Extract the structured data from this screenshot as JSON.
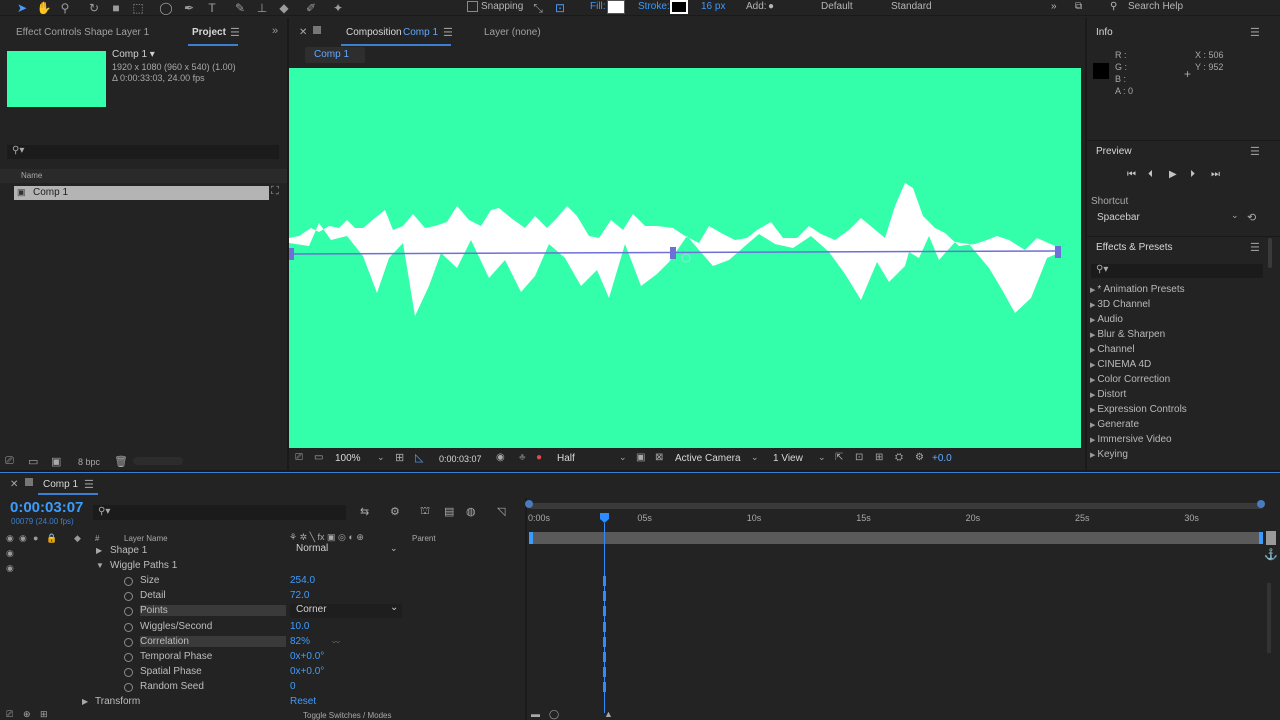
{
  "toolbar": {
    "snapping_label": "Snapping",
    "fill_label": "Fill:",
    "stroke_label": "Stroke:",
    "stroke_size": "16 px",
    "add_label": "Add:",
    "workspace_default": "Default",
    "workspace_standard": "Standard",
    "search_help": "Search Help"
  },
  "left_panel": {
    "tab_effect_controls": "Effect Controls Shape Layer 1",
    "tab_project": "Project",
    "comp_name": "Comp 1 ▾",
    "comp_dims": "1920 x 1080  (960 x 540) (1.00)",
    "comp_duration": "Δ 0:00:33:03, 24.00 fps",
    "thumb_color": "#33ffaa",
    "search_placeholder": "",
    "column_name": "Name",
    "items": [
      {
        "label": "Comp 1"
      }
    ],
    "footer_bpc": "8 bpc"
  },
  "viewer": {
    "tab_composition": "Composition",
    "tab_comp_name": "Comp 1",
    "tab_layer": "Layer (none)",
    "breadcrumb": "Comp 1",
    "bg_color": "#33ffaa",
    "zoom": "100%",
    "timecode": "0:00:03:07",
    "resolution": "Half",
    "camera": "Active Camera",
    "view": "1 View",
    "exposure": "+0.0"
  },
  "info_panel": {
    "title": "Info",
    "r_label": "R :",
    "g_label": "G :",
    "b_label": "B :",
    "a_label": "A : 0",
    "x_label": "X : 506",
    "y_label": "Y : 952"
  },
  "preview_panel": {
    "title": "Preview",
    "shortcut_label": "Shortcut",
    "shortcut_value": "Spacebar"
  },
  "effects_panel": {
    "title": "Effects & Presets",
    "search_placeholder": "",
    "items": [
      {
        "label": "* Animation Presets"
      },
      {
        "label": "3D Channel"
      },
      {
        "label": "Audio"
      },
      {
        "label": "Blur & Sharpen"
      },
      {
        "label": "Channel"
      },
      {
        "label": "CINEMA 4D"
      },
      {
        "label": "Color Correction"
      },
      {
        "label": "Distort"
      },
      {
        "label": "Expression Controls"
      },
      {
        "label": "Generate"
      },
      {
        "label": "Immersive Video"
      },
      {
        "label": "Keying"
      }
    ]
  },
  "timeline": {
    "tab_name": "Comp 1",
    "timecode": "0:00:03:07",
    "frame_info": "00079 (24.00 fps)",
    "col_layer_name": "Layer Name",
    "col_parent": "Parent",
    "col_hash": "#",
    "ruler": [
      "0:00s",
      "05s",
      "10s",
      "15s",
      "20s",
      "25s",
      "30s"
    ],
    "shape_row": "Shape 1",
    "blend_mode": "Normal",
    "wiggle_group": "Wiggle Paths 1",
    "properties": [
      {
        "name": "Size",
        "value": "254.0"
      },
      {
        "name": "Detail",
        "value": "72.0"
      },
      {
        "name": "Points",
        "value": "Corner"
      },
      {
        "name": "Wiggles/Second",
        "value": "10.0"
      },
      {
        "name": "Correlation",
        "value": "82%"
      },
      {
        "name": "Temporal Phase",
        "value": "0x+0.0°"
      },
      {
        "name": "Spatial Phase",
        "value": "0x+0.0°"
      },
      {
        "name": "Random Seed",
        "value": "0"
      }
    ],
    "transform_row": "Transform",
    "transform_value": "Reset",
    "toggle_label": "Toggle Switches / Modes"
  }
}
